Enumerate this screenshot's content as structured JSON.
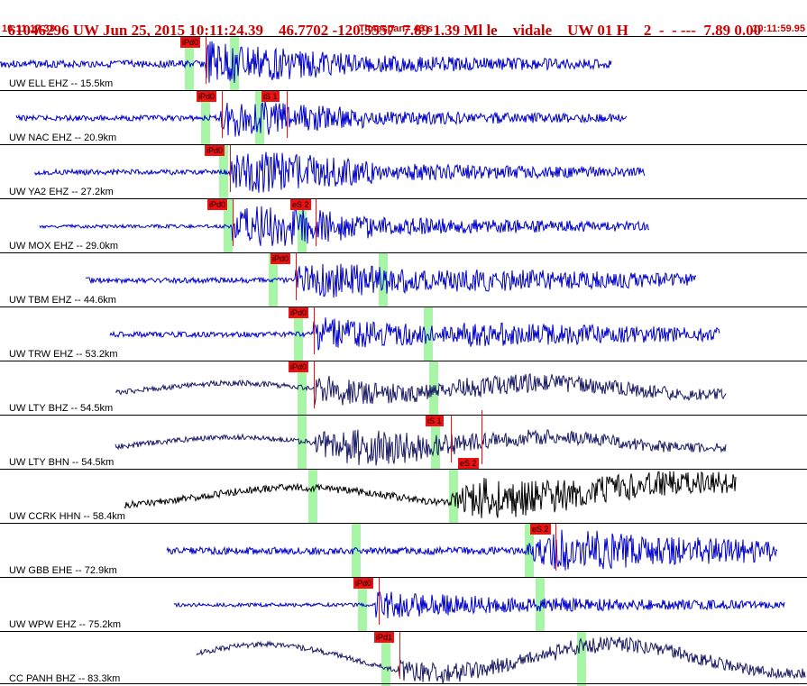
{
  "header": {
    "title_left": "61046296 UW Jun 25, 2015 10:11:24.39    46.7702 -120.5557  7.89 1.39 Ml le    vidale    UW 01 H    2  -  - ---  7.89 0.00",
    "start_time": "10:11:17.33",
    "timespan": "Timespan=  43 s",
    "end_time": "10:11:59.95"
  },
  "colors": {
    "header_red": "#cc0000",
    "trace_blue": "#0000cc",
    "trace_navy": "#1a1a66",
    "trace_black": "#000000",
    "pick_red": "#ee1111",
    "window_green": "#a8f5a8"
  },
  "panels": [
    {
      "label": "UW ELL EHZ -- 15.5km",
      "picks": [
        "iPd0"
      ]
    },
    {
      "label": "UW NAC EHZ -- 20.9km",
      "picks": [
        "iPd0",
        "iS 1"
      ]
    },
    {
      "label": "UW YA2 EHZ -- 27.2km",
      "picks": [
        "iPd0"
      ]
    },
    {
      "label": "UW MOX EHZ -- 29.0km",
      "picks": [
        "iPd0",
        "eS 2"
      ]
    },
    {
      "label": "UW TBM EHZ -- 44.6km",
      "picks": [
        "iPd0"
      ]
    },
    {
      "label": "UW TRW EHZ -- 53.2km",
      "picks": [
        "iPd0"
      ]
    },
    {
      "label": "UW LTY BHZ -- 54.5km",
      "picks": [
        "iPd0"
      ]
    },
    {
      "label": "UW LTY BHN -- 54.5km",
      "picks": [
        "iS 1",
        "eS 2"
      ]
    },
    {
      "label": "UW CCRK HHN -- 58.4km",
      "picks": []
    },
    {
      "label": "UW GBB EHE -- 72.9km",
      "picks": [
        "eS 2"
      ]
    },
    {
      "label": "UW WPW EHZ -- 75.2km",
      "picks": [
        "iPd0"
      ]
    },
    {
      "label": "CC PANH BHZ -- 83.3km",
      "picks": [
        "iPd1"
      ]
    }
  ]
}
